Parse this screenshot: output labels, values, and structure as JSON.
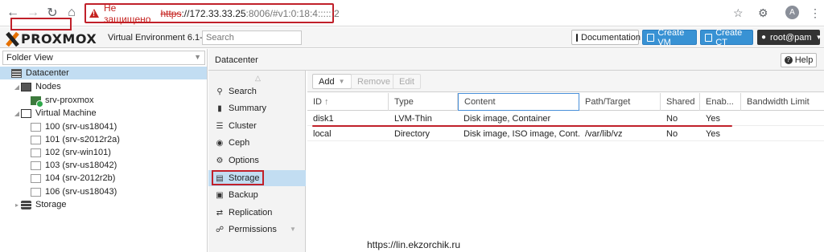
{
  "browser": {
    "not_secure": "Не защищено",
    "url_proto": "https",
    "url_host": "://172.33.33.25",
    "url_path": ":8006/#v1:0:18:4::::::2",
    "avatar_letter": "A"
  },
  "header": {
    "logo": "PROXMOX",
    "version": "Virtual Environment 6.1-5",
    "search_placeholder": "Search",
    "documentation": "Documentation",
    "create_vm": "Create VM",
    "create_ct": "Create CT",
    "user": "root@pam"
  },
  "tree": {
    "view_select": "Folder View",
    "items": [
      {
        "label": "Datacenter",
        "icon": "datacenter-icon"
      },
      {
        "label": "Nodes",
        "icon": "server-icon"
      },
      {
        "label": "srv-proxmox",
        "icon": "node-online-icon"
      },
      {
        "label": "Virtual Machine",
        "icon": "monitor-icon"
      },
      {
        "label": "100 (srv-us18041)",
        "icon": "vm-icon"
      },
      {
        "label": "101 (srv-s2012r2a)",
        "icon": "vm-icon"
      },
      {
        "label": "102 (srv-win101)",
        "icon": "vm-icon"
      },
      {
        "label": "103 (srv-us18042)",
        "icon": "vm-icon"
      },
      {
        "label": "104 (srv-2012r2b)",
        "icon": "vm-icon"
      },
      {
        "label": "106 (srv-us18043)",
        "icon": "vm-icon"
      },
      {
        "label": "Storage",
        "icon": "storage-icon"
      }
    ]
  },
  "panel": {
    "title": "Datacenter",
    "help": "Help"
  },
  "nav": [
    {
      "label": "Search",
      "icon": "search-icon"
    },
    {
      "label": "Summary",
      "icon": "book-icon"
    },
    {
      "label": "Cluster",
      "icon": "cluster-icon"
    },
    {
      "label": "Ceph",
      "icon": "ceph-icon"
    },
    {
      "label": "Options",
      "icon": "gear-icon"
    },
    {
      "label": "Storage",
      "icon": "database-icon"
    },
    {
      "label": "Backup",
      "icon": "floppy-icon"
    },
    {
      "label": "Replication",
      "icon": "retweet-icon"
    },
    {
      "label": "Permissions",
      "icon": "unlock-icon"
    }
  ],
  "toolbar": {
    "add": "Add",
    "remove": "Remove",
    "edit": "Edit"
  },
  "grid": {
    "columns": [
      "ID",
      "Type",
      "Content",
      "Path/Target",
      "Shared",
      "Enab...",
      "Bandwidth Limit"
    ],
    "rows": [
      [
        "disk1",
        "LVM-Thin",
        "Disk image, Container",
        "",
        "No",
        "Yes",
        ""
      ],
      [
        "local",
        "Directory",
        "Disk image, ISO image, Cont...",
        "/var/lib/vz",
        "No",
        "Yes",
        ""
      ]
    ]
  },
  "watermark": "https://lin.ekzorchik.ru",
  "colors": {
    "accent": "#3892d4",
    "selection": "#c2ddf2",
    "highlight_red": "#c0202a",
    "proxmox_orange": "#e57000"
  }
}
